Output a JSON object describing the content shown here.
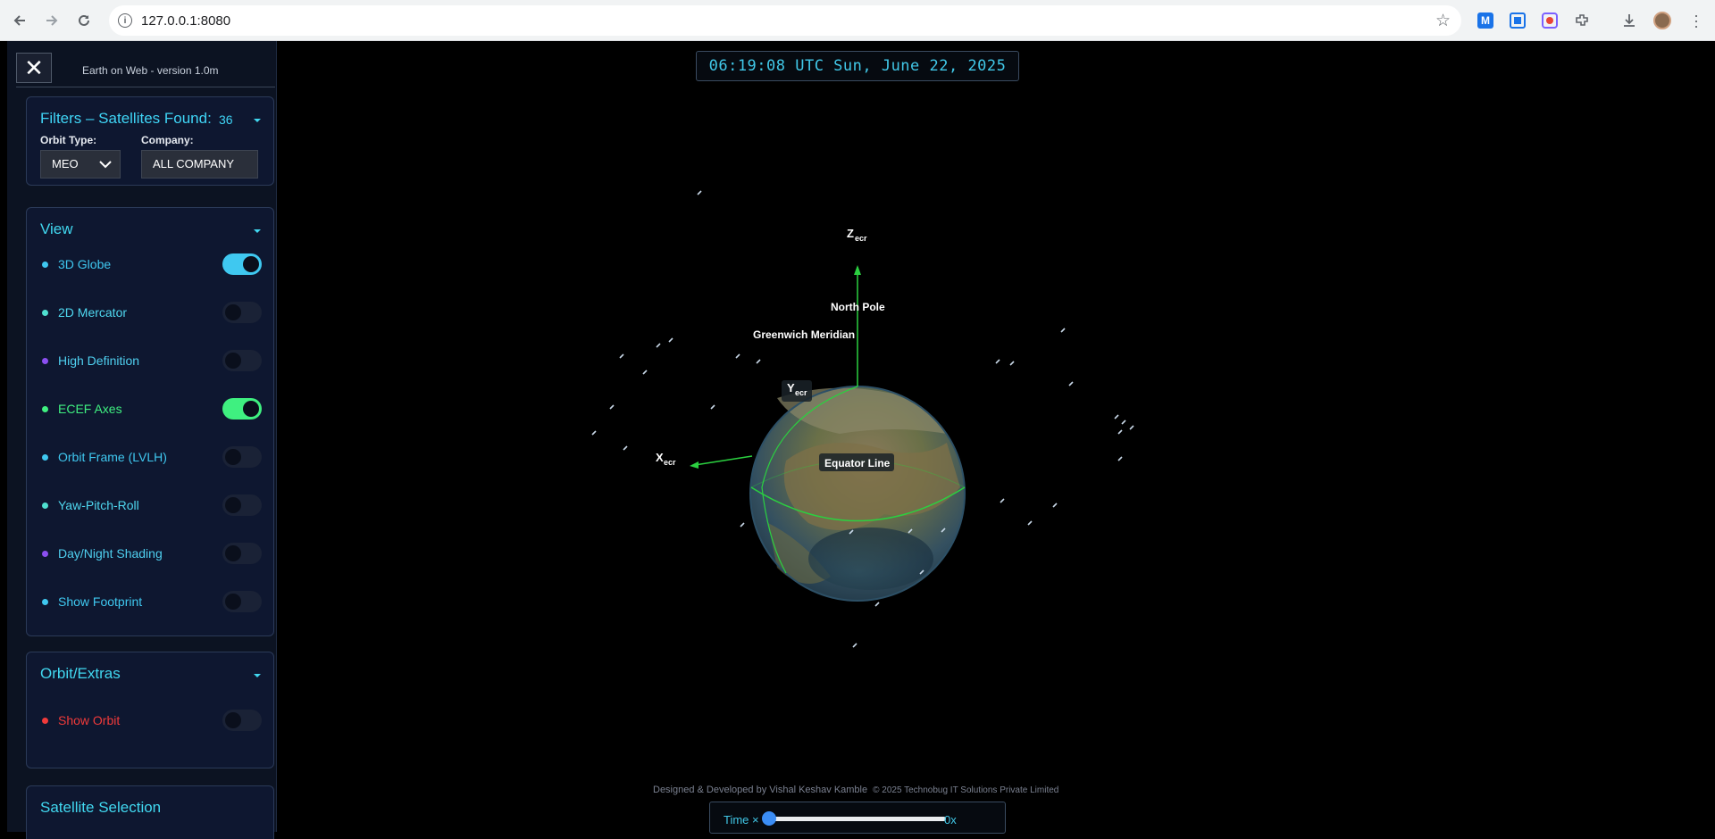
{
  "browser": {
    "url": "127.0.0.1:8080",
    "back_icon": "arrow-left-icon",
    "forward_icon": "arrow-right-icon",
    "reload_icon": "reload-icon"
  },
  "panel": {
    "close_label": "✕",
    "version": "Earth on Web - version 1.0m",
    "filters": {
      "title": "Filters – Satellites Found:",
      "count": "36",
      "orbit_type_label": "Orbit Type:",
      "orbit_type_value": "MEO",
      "company_label": "Company:",
      "company_value": "ALL COMPANY"
    },
    "view": {
      "title": "View",
      "items": [
        {
          "label": "3D Globe",
          "on": true,
          "dot": "#3fc8f0",
          "color": "#3fc8f0",
          "toggle": "#3fc8f0"
        },
        {
          "label": "2D Mercator",
          "on": false,
          "dot": "#4fe0d0",
          "color": "#4fd8f0"
        },
        {
          "label": "High Definition",
          "on": false,
          "dot": "#8b4ff0",
          "color": "#4fd0f0"
        },
        {
          "label": "ECEF Axes",
          "on": true,
          "dot": "#3ff080",
          "color": "#3ff080",
          "toggle": "#3ff080"
        },
        {
          "label": "Orbit Frame (LVLH)",
          "on": false,
          "dot": "#3fc8f0",
          "color": "#3fc8f0"
        },
        {
          "label": "Yaw-Pitch-Roll",
          "on": false,
          "dot": "#4fe0d0",
          "color": "#4fd8f0"
        },
        {
          "label": "Day/Night Shading",
          "on": false,
          "dot": "#8b4ff0",
          "color": "#4fd0f0"
        },
        {
          "label": "Show Footprint",
          "on": false,
          "dot": "#3fc8f0",
          "color": "#3fc8f0"
        }
      ]
    },
    "orbit": {
      "title": "Orbit/Extras",
      "items": [
        {
          "label": "Show Orbit",
          "on": false,
          "dot": "#f03a3a",
          "color": "#f03a3a"
        }
      ]
    },
    "selection": {
      "title": "Satellite Selection"
    }
  },
  "scene": {
    "clock": "06:19:08 UTC Sun, June 22, 2025",
    "labels": {
      "z_axis": "Z",
      "z_sub": "ecr",
      "y_axis": "Y",
      "y_sub": "ecr",
      "x_axis": "X",
      "x_sub": "ecr",
      "north_pole": "North Pole",
      "greenwich": "Greenwich Meridian",
      "equator": "Equator Line"
    },
    "credit": "Designed & Developed by Vishal Keshav Kamble",
    "copyright": "© 2025 Technobug IT Solutions Private Limited",
    "time_label": "Time ×",
    "time_value": "0x",
    "time_multiplier": 0
  }
}
